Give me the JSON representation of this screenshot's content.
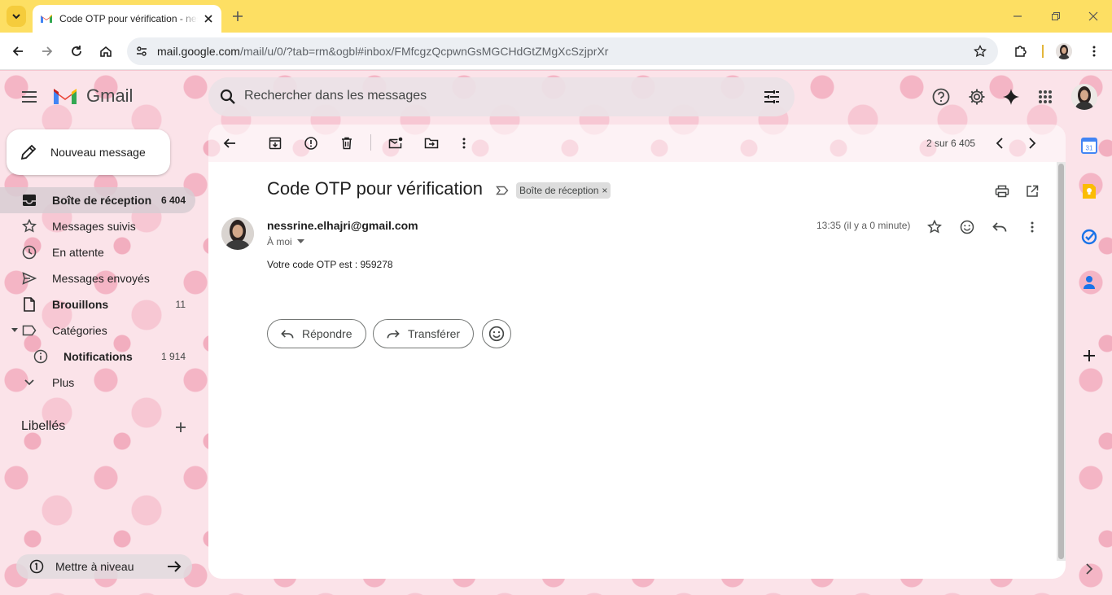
{
  "browser": {
    "tab_title": "Code OTP pour vérification - nessrine.elhajri@gmail.com - Gmail",
    "url_host": "mail.google.com",
    "url_path": "/mail/u/0/?tab=rm&ogbl#inbox/FMfcgzQcpwnGsMGCHdGtZMgXcSzjprXr"
  },
  "app": {
    "name": "Gmail"
  },
  "search": {
    "placeholder": "Rechercher dans les messages"
  },
  "compose": {
    "label": "Nouveau message"
  },
  "nav": {
    "items": [
      {
        "label": "Boîte de réception",
        "count": "6 404"
      },
      {
        "label": "Messages suivis",
        "count": ""
      },
      {
        "label": "En attente",
        "count": ""
      },
      {
        "label": "Messages envoyés",
        "count": ""
      },
      {
        "label": "Brouillons",
        "count": "11"
      },
      {
        "label": "Catégories",
        "count": ""
      },
      {
        "label": "Notifications",
        "count": "1 914"
      },
      {
        "label": "Plus",
        "count": ""
      }
    ],
    "labels_heading": "Libellés",
    "upgrade_label": "Mettre à niveau"
  },
  "toolbar": {
    "pager": "2 sur 6 405"
  },
  "message": {
    "subject": "Code OTP pour vérification",
    "label_chip": "Boîte de réception",
    "sender": "nessrine.elhajri@gmail.com",
    "recipient": "À moi",
    "time": "13:35 (il y a 0 minute)",
    "body": "Votre code OTP est : 959278",
    "reply_label": "Répondre",
    "forward_label": "Transférer"
  },
  "colors": {
    "tabbar": "#fddf63",
    "theme_bg": "#fbe3e9",
    "active_nav": "#d7cdd2"
  }
}
